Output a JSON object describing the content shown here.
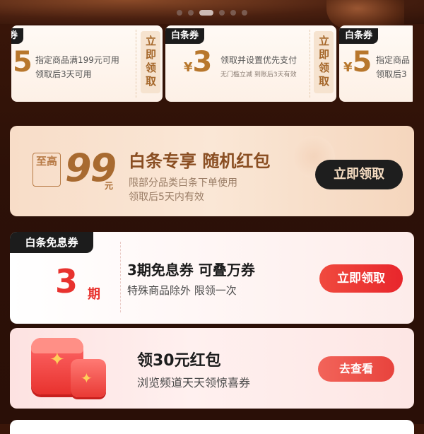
{
  "carousel": {
    "dot_count": 6,
    "active_index": 2
  },
  "coupons": [
    {
      "tag": "券",
      "amount": "5",
      "currency": "",
      "condition": "指定商品满199元可用",
      "sub": "领取后3天可用",
      "claim": "立即领取"
    },
    {
      "tag": "白条券",
      "amount": "3",
      "currency": "¥",
      "condition": "领取并设置优先支付",
      "sub": "无门槛立减 到账后3天有效",
      "claim": "立即领取"
    },
    {
      "tag": "白条券",
      "amount": "5",
      "currency": "¥",
      "condition": "指定商品",
      "sub": "领取后3"
    }
  ],
  "random_packet": {
    "max_label": "至高",
    "max_value": "99",
    "max_unit": "元",
    "title": "白条专享 随机红包",
    "desc1": "限部分品类白条下单使用",
    "desc2": "领取后5天内有效",
    "button": "立即领取"
  },
  "interest_free": {
    "tag": "白条免息券",
    "value": "3",
    "unit": "期",
    "title": "3期免息券 可叠万券",
    "desc": "特殊商品除外 限领一次",
    "button": "立即领取"
  },
  "red_packet": {
    "title": "领30元红包",
    "desc": "浏览频道天天领惊喜券",
    "button": "去查看"
  },
  "colors": {
    "accent_red": "#e8322e",
    "gold": "#a86a30",
    "dark": "#1e1e1e"
  }
}
